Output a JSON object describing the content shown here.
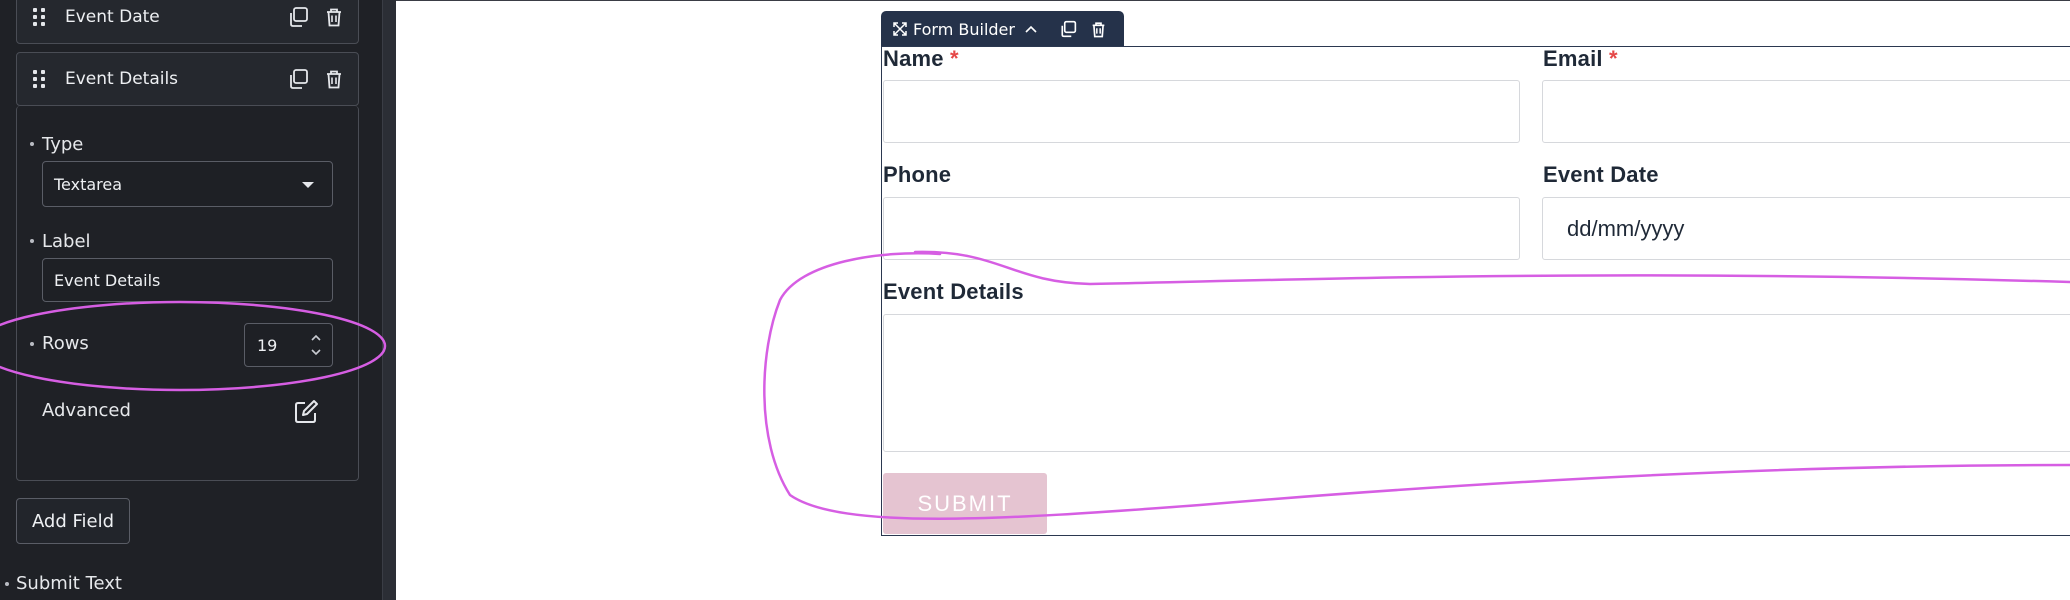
{
  "sidebar": {
    "fields": [
      {
        "label": "Event Date"
      },
      {
        "label": "Event Details"
      }
    ],
    "properties": {
      "type_label": "Type",
      "type_value": "Textarea",
      "label_label": "Label",
      "label_value": "Event Details",
      "rows_label": "Rows",
      "rows_value": "19",
      "advanced_label": "Advanced"
    },
    "add_field_label": "Add Field",
    "submit_text_label": "Submit Text"
  },
  "form_builder": {
    "tab_title": "Form Builder",
    "fields": {
      "name_label": "Name",
      "email_label": "Email",
      "required_mark": "*",
      "phone_label": "Phone",
      "event_date_label": "Event Date",
      "date_placeholder": "dd/mm/yyyy",
      "event_details_label": "Event Details"
    },
    "submit_label": "SUBMIT"
  },
  "colors": {
    "panel_bg": "#1f2126",
    "tab_bg": "#25324a",
    "required": "#e54848",
    "submit_bg": "#e5c4d1",
    "annotation": "#d65ee3"
  }
}
